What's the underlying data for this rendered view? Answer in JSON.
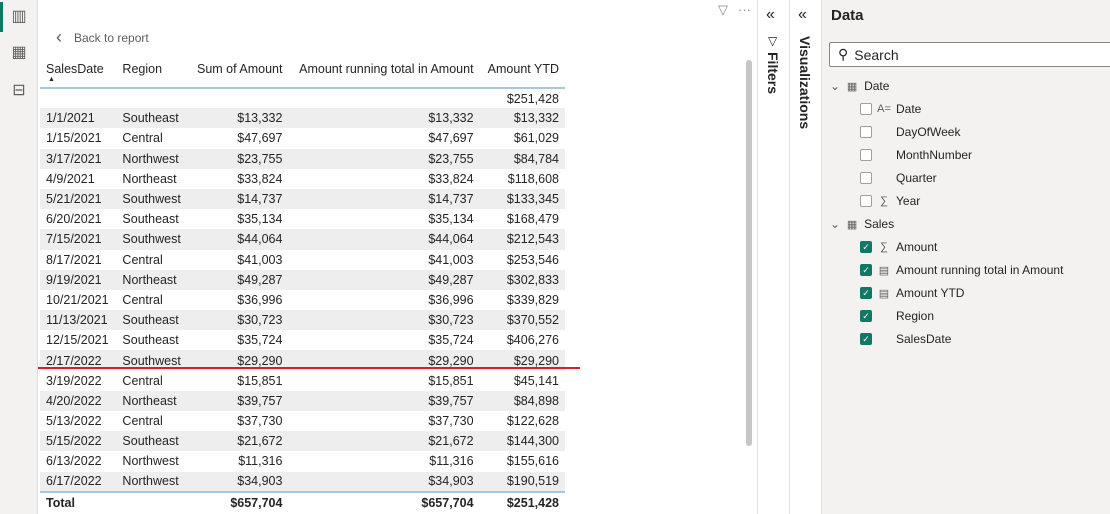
{
  "nav": {
    "back_label": "Back to report"
  },
  "table": {
    "columns": [
      "SalesDate",
      "Region",
      "Sum of Amount",
      "Amount running total in Amount",
      "Amount YTD"
    ],
    "blank_row_ytd": "$251,428",
    "rows": [
      [
        "1/1/2021",
        "Southeast",
        "$13,332",
        "$13,332",
        "$13,332"
      ],
      [
        "1/15/2021",
        "Central",
        "$47,697",
        "$47,697",
        "$61,029"
      ],
      [
        "3/17/2021",
        "Northwest",
        "$23,755",
        "$23,755",
        "$84,784"
      ],
      [
        "4/9/2021",
        "Northeast",
        "$33,824",
        "$33,824",
        "$118,608"
      ],
      [
        "5/21/2021",
        "Southwest",
        "$14,737",
        "$14,737",
        "$133,345"
      ],
      [
        "6/20/2021",
        "Southeast",
        "$35,134",
        "$35,134",
        "$168,479"
      ],
      [
        "7/15/2021",
        "Southwest",
        "$44,064",
        "$44,064",
        "$212,543"
      ],
      [
        "8/17/2021",
        "Central",
        "$41,003",
        "$41,003",
        "$253,546"
      ],
      [
        "9/19/2021",
        "Northeast",
        "$49,287",
        "$49,287",
        "$302,833"
      ],
      [
        "10/21/2021",
        "Central",
        "$36,996",
        "$36,996",
        "$339,829"
      ],
      [
        "11/13/2021",
        "Southeast",
        "$30,723",
        "$30,723",
        "$370,552"
      ],
      [
        "12/15/2021",
        "Southeast",
        "$35,724",
        "$35,724",
        "$406,276"
      ],
      [
        "2/17/2022",
        "Southwest",
        "$29,290",
        "$29,290",
        "$29,290"
      ],
      [
        "3/19/2022",
        "Central",
        "$15,851",
        "$15,851",
        "$45,141"
      ],
      [
        "4/20/2022",
        "Northeast",
        "$39,757",
        "$39,757",
        "$84,898"
      ],
      [
        "5/13/2022",
        "Central",
        "$37,730",
        "$37,730",
        "$122,628"
      ],
      [
        "5/15/2022",
        "Southeast",
        "$21,672",
        "$21,672",
        "$144,300"
      ],
      [
        "6/13/2022",
        "Northwest",
        "$11,316",
        "$11,316",
        "$155,616"
      ],
      [
        "6/17/2022",
        "Northwest",
        "$34,903",
        "$34,903",
        "$190,519"
      ]
    ],
    "total": [
      "Total",
      "",
      "$657,704",
      "$657,704",
      "$251,428"
    ]
  },
  "panes": {
    "filters": "Filters",
    "visualizations": "Visualizations"
  },
  "data_pane": {
    "title": "Data",
    "search_placeholder": "Search",
    "tables": [
      {
        "name": "Date",
        "fields": [
          {
            "name": "Date",
            "checked": false,
            "icon": "text-icon"
          },
          {
            "name": "DayOfWeek",
            "checked": false,
            "icon": ""
          },
          {
            "name": "MonthNumber",
            "checked": false,
            "icon": ""
          },
          {
            "name": "Quarter",
            "checked": false,
            "icon": ""
          },
          {
            "name": "Year",
            "checked": false,
            "icon": "sigma-icon"
          }
        ]
      },
      {
        "name": "Sales",
        "fields": [
          {
            "name": "Amount",
            "checked": true,
            "icon": "sigma-icon"
          },
          {
            "name": "Amount running total in Amount",
            "checked": true,
            "icon": "calculator-icon"
          },
          {
            "name": "Amount YTD",
            "checked": true,
            "icon": "calculator-icon"
          },
          {
            "name": "Region",
            "checked": true,
            "icon": ""
          },
          {
            "name": "SalesDate",
            "checked": true,
            "icon": ""
          }
        ]
      }
    ]
  },
  "colors": {
    "accent": "#117865",
    "highlight_line": "#d32030"
  }
}
